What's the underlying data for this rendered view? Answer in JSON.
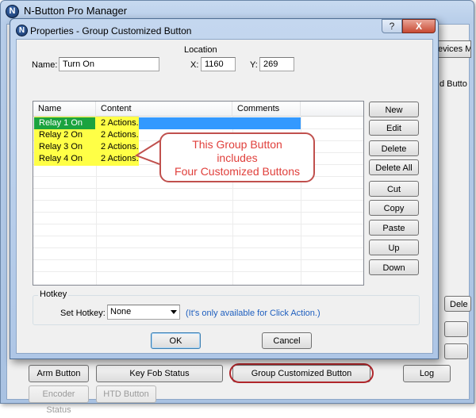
{
  "main_window": {
    "title": "N-Button Pro Manager",
    "partial_tab": "evices Ma",
    "partial_label": "d Butto",
    "partial_button": "Dele",
    "bottom_buttons": {
      "arm": "Arm Button",
      "key_fob": "Key Fob Status",
      "group_customized": "Group Customized Button",
      "log": "Log",
      "encoder": "Encoder Status",
      "htd": "HTD Button"
    }
  },
  "dialog": {
    "title": "Properties - Group Customized Button",
    "help_glyph": "?",
    "close_glyph": "X",
    "name_label": "Name:",
    "name_value": "Turn On",
    "location": {
      "label": "Location",
      "x_label": "X:",
      "x_value": "1160",
      "y_label": "Y:",
      "y_value": "269"
    },
    "list": {
      "columns": [
        "Name",
        "Content",
        "Comments"
      ],
      "rows": [
        {
          "name": "Relay 1 On",
          "content": "2 Actions.",
          "comments": ""
        },
        {
          "name": "Relay 2 On",
          "content": "2 Actions.",
          "comments": ""
        },
        {
          "name": "Relay 3 On",
          "content": "2 Actions.",
          "comments": ""
        },
        {
          "name": "Relay 4 On",
          "content": "2 Actions.",
          "comments": ""
        }
      ]
    },
    "callout_lines": [
      "This Group Button",
      "includes",
      "Four Customized Buttons"
    ],
    "side_buttons": {
      "new": "New",
      "edit": "Edit",
      "delete": "Delete",
      "delete_all": "Delete All",
      "cut": "Cut",
      "copy": "Copy",
      "paste": "Paste",
      "up": "Up",
      "down": "Down"
    },
    "hotkey": {
      "group_label": "Hotkey",
      "set_label": "Set Hotkey:",
      "selected": "None",
      "hint": "(It's only available for Click Action.)"
    },
    "ok": "OK",
    "cancel": "Cancel"
  },
  "colors": {
    "highlight_yellow": "#ffff46",
    "highlight_green": "#1ba33f",
    "selection_blue": "#3399ff",
    "annotation_red": "#c0504d"
  }
}
